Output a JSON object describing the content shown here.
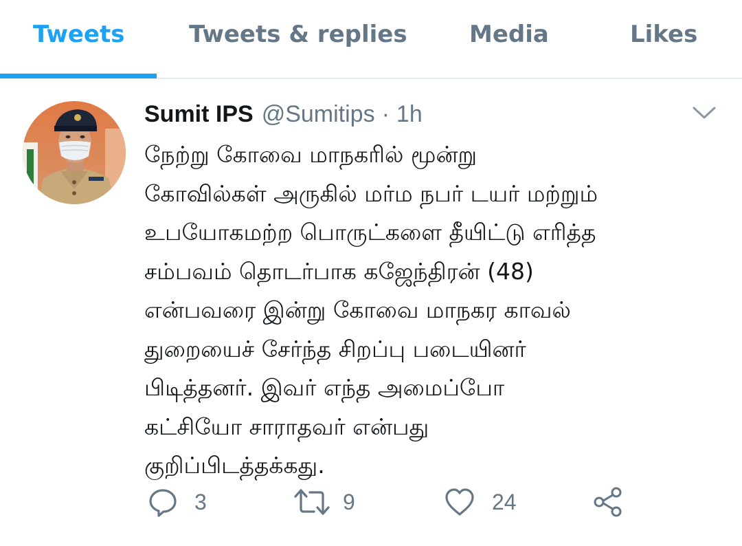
{
  "tabs": [
    {
      "label": "Tweets",
      "active": true
    },
    {
      "label": "Tweets & replies",
      "active": false
    },
    {
      "label": "Media",
      "active": false
    },
    {
      "label": "Likes",
      "active": false
    }
  ],
  "tweet": {
    "author_name": "Sumit IPS",
    "handle": "@Sumitips",
    "separator": "·",
    "time": "1h",
    "lines": [
      "நேற்று கோவை மாநகரில் மூன்று",
      "கோவில்கள் அருகில் மர்ம நபர் டயர் மற்றும்",
      "உபயோகமற்ற பொருட்களை தீயிட்டு எரித்த",
      "சம்பவம் தொடர்பாக  கஜேந்திரன் (48)",
      "என்பவரை இன்று கோவை மாநகர காவல்",
      "துறையைச் சேர்ந்த சிறப்பு படையினர்",
      "பிடித்தனர். இவர் எந்த அமைப்போ",
      "கட்சியோ சாராதவர் என்பது",
      "குறிப்பிடத்தக்கது."
    ],
    "replies": "3",
    "retweets": "9",
    "likes": "24"
  },
  "icons": {
    "reply": "reply-icon",
    "retweet": "retweet-icon",
    "like": "heart-icon",
    "share": "share-icon",
    "menu": "chevron-down-icon"
  },
  "colors": {
    "accent": "#1da1f2",
    "secondary_text": "#657786",
    "primary_text": "#14171a",
    "divider": "#e6ecf0"
  }
}
